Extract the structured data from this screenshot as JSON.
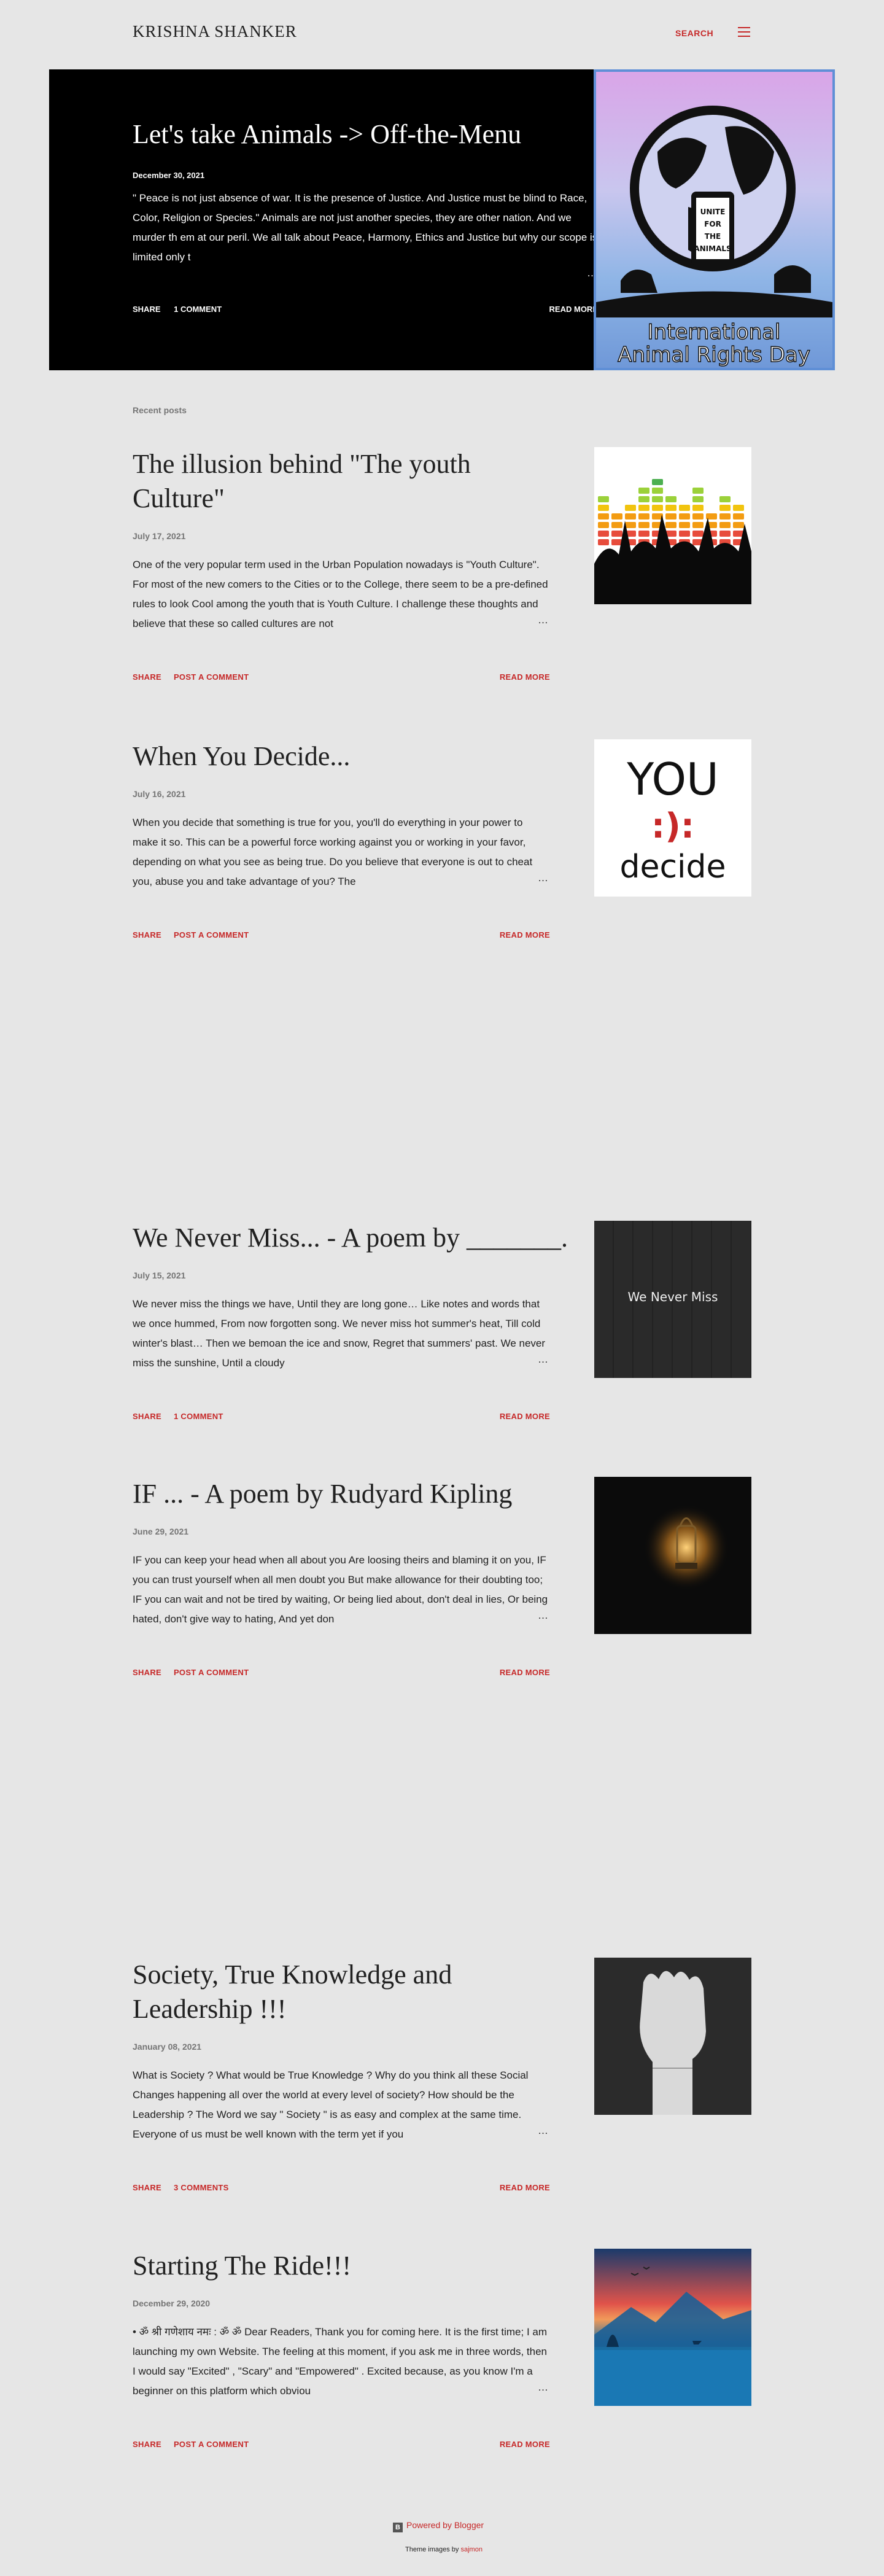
{
  "header": {
    "site_title": "KRISHNA SHANKER",
    "search_label": "SEARCH",
    "menu_icon": "hamburger-icon"
  },
  "featured": {
    "title": "Let's take Animals -> Off-the-Menu",
    "date": "December 30, 2021",
    "snippet": "\" Peace is not just absence of war. It is the presence of Justice. And Justice must be blind to Race, Color, Religion or Species.\"  Animals are not just another species, they are other nation. And we murder th em at our peril. We all talk about Peace, Harmony, Ethics and Justice but  why our scope is limited only t",
    "share_label": "SHARE",
    "comments_label": "1 COMMENT",
    "read_more_label": "READ MORE",
    "image_caption_line1": "International",
    "image_caption_line2": "Animal Rights Day",
    "image_sign_text": [
      "UNITE",
      "FOR",
      "THE",
      "ANIMALS"
    ]
  },
  "recent_label": "Recent posts",
  "posts": [
    {
      "title": "The illusion behind \"The youth Culture\"",
      "date": "July 17, 2021",
      "snippet": "One of the very popular term used in the Urban Population nowadays is \"Youth Culture\". For most of the new comers to the Cities or to the College, there seem to be a pre-defined rules to look Cool among the youth that is Youth Culture. I challenge these thoughts and believe that these so called cultures are not",
      "share_label": "SHARE",
      "comments_label": "POST A COMMENT",
      "read_more_label": "READ MORE",
      "ellipsis": "…"
    },
    {
      "title": "When You Decide...",
      "date": "July 16, 2021",
      "snippet": "  When you decide that something is true for you, you'll do everything in your power to make it so. This can be a powerful force working against you or working in your favor, depending on what you see as being true. Do you believe that everyone is out to cheat you, abuse you and take advantage of you? The",
      "share_label": "SHARE",
      "comments_label": "POST A COMMENT",
      "read_more_label": "READ MORE",
      "ellipsis": "…",
      "thumb_text_top": "YOU",
      "thumb_text_mid": ":):",
      "thumb_text_bottom": "decide"
    },
    {
      "title": "We Never Miss... - A poem by _______.",
      "date": "July 15, 2021",
      "snippet": "We never miss the things we have,       Until they are long gone… Like notes and words that we once hummed,       From now forgotten song. We never miss hot summer's heat,       Till cold winter's blast… Then we bemoan the ice and snow,       Regret that summers' past. We never miss the sunshine,       Until a cloudy",
      "share_label": "SHARE",
      "comments_label": "1 COMMENT",
      "read_more_label": "READ MORE",
      "ellipsis": "…",
      "thumb_text": "We Never Miss"
    },
    {
      "title": "IF ... - A poem by Rudyard Kipling",
      "date": "June 29, 2021",
      "snippet": "IF you can keep your head when all about you Are loosing theirs and blaming it on you, IF you can trust yourself when all men doubt you But make allowance for their doubting too; IF you can wait and not be tired by waiting, Or being lied about, don't deal in lies, Or being hated, don't give way to hating, And yet don",
      "share_label": "SHARE",
      "comments_label": "POST A COMMENT",
      "read_more_label": "READ MORE",
      "ellipsis": "…"
    },
    {
      "title": "Society, True Knowledge and Leadership !!!",
      "date": "January 08, 2021",
      "snippet": "  What is Society ? What would be True Knowledge ? Why do you think all these Social Changes happening all over the world at every level of society? How should be the Leadership ? The Word we say \" Society \" is as easy and complex at the same time. Everyone of us must be well known with the term yet if you",
      "share_label": "SHARE",
      "comments_label": "3 COMMENTS",
      "read_more_label": "READ MORE",
      "ellipsis": "…"
    },
    {
      "title": "Starting The Ride!!!",
      "date": "December 29, 2020",
      "snippet": "•   ॐ  श्री गणेशाय नमः  : ॐ ॐ   Dear Readers, Thank you for coming here. It is the first time; I am launching my own Website. The feeling at this moment, if you ask me in three words, then I would say  \"Excited\" ,  \"Scary\"  and  \"Empowered\" . Excited  because, as you know I'm a beginner on this platform which obviou",
      "share_label": "SHARE",
      "comments_label": "POST A COMMENT",
      "read_more_label": "READ MORE",
      "ellipsis": "…"
    }
  ],
  "footer": {
    "powered_by": "Powered by Blogger",
    "theme_prefix": "Theme images by",
    "theme_author": "sajmon"
  }
}
